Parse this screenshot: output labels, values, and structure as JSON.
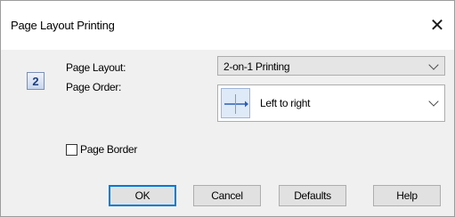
{
  "dialog": {
    "title": "Page Layout Printing",
    "close_glyph": "✕"
  },
  "step_badge": "2",
  "page_layout": {
    "label": "Page Layout:",
    "value": "2-on-1 Printing"
  },
  "page_order": {
    "label": "Page Order:",
    "value": "Left to right",
    "icon": "left-to-right-order-icon"
  },
  "page_border": {
    "label": "Page Border",
    "checked": false
  },
  "buttons": {
    "ok": "OK",
    "cancel": "Cancel",
    "defaults": "Defaults",
    "help": "Help"
  },
  "colors": {
    "default_button_border": "#0078d7",
    "dialog_bg": "#f0f0f0"
  }
}
